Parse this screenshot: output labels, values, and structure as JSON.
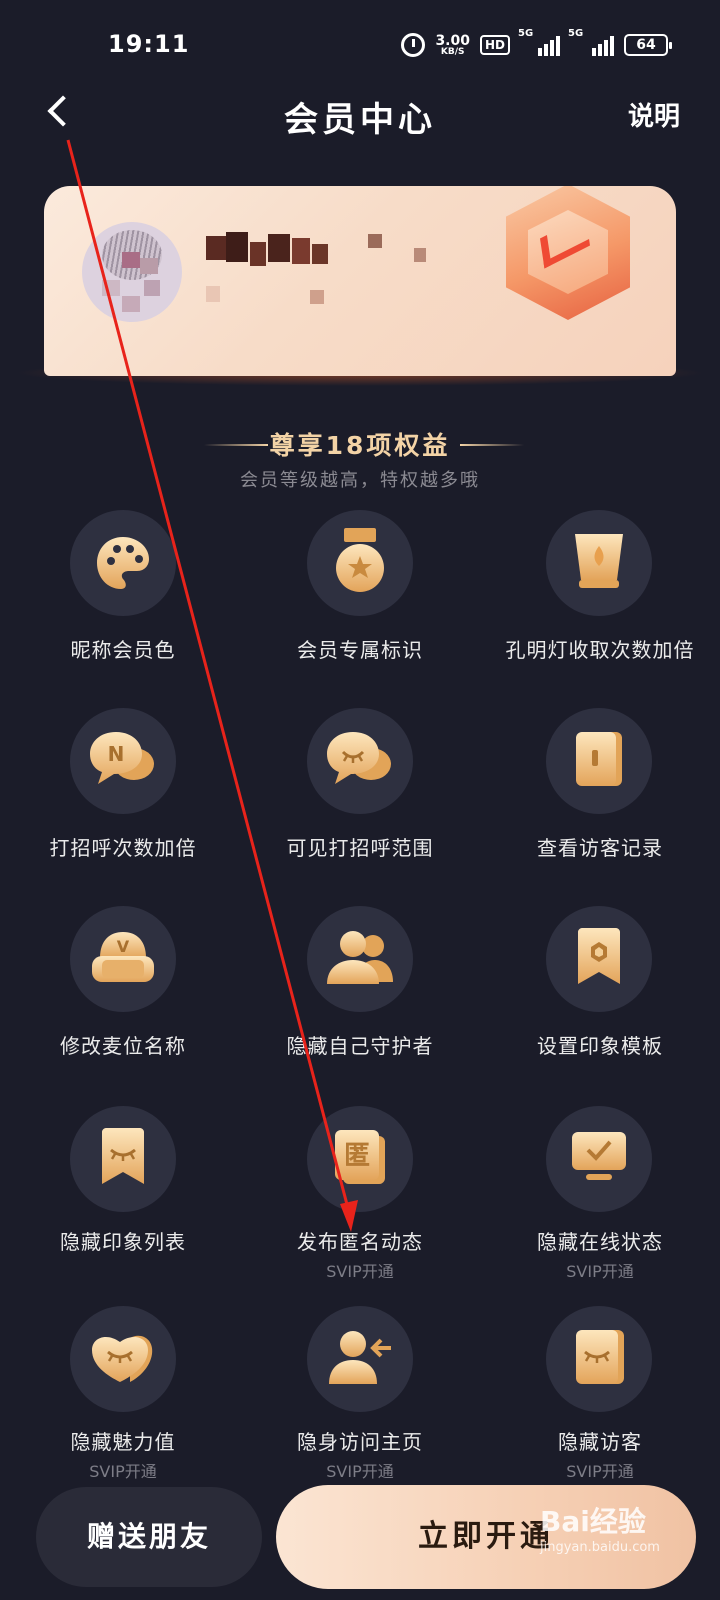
{
  "status_bar": {
    "time": "19:11",
    "net_speed": "3.00",
    "net_unit": "KB/S",
    "hd": "HD",
    "signal1": "5G",
    "signal2": "5G",
    "battery": "64",
    "icons": [
      "alarm-icon",
      "hd-icon",
      "signal-icon",
      "signal-icon",
      "battery-icon"
    ]
  },
  "header": {
    "title": "会员中心",
    "help": "说明",
    "back_icon": "back-chevron-icon"
  },
  "benefits": {
    "title": "尊享18项权益",
    "subtitle": "会员等级越高，特权越多哦",
    "items": [
      {
        "label": "昵称会员色",
        "icon": "palette-icon"
      },
      {
        "label": "会员专属标识",
        "icon": "medal-icon"
      },
      {
        "label": "孔明灯收取次数加倍",
        "icon": "lantern-icon"
      },
      {
        "label": "打招呼次数加倍",
        "icon": "chat-bubble-n-icon"
      },
      {
        "label": "可见打招呼范围",
        "icon": "chat-bubble-eye-icon"
      },
      {
        "label": "查看访客记录",
        "icon": "visitor-record-icon"
      },
      {
        "label": "修改麦位名称",
        "icon": "seat-icon"
      },
      {
        "label": "隐藏自己守护者",
        "icon": "users-icon"
      },
      {
        "label": "设置印象模板",
        "icon": "bookmark-template-icon"
      },
      {
        "label": "隐藏印象列表",
        "icon": "bookmark-hidden-icon"
      },
      {
        "label": "发布匿名动态",
        "note": "SVIP开通",
        "icon": "anonymous-icon",
        "icon_text": "匿"
      },
      {
        "label": "隐藏在线状态",
        "note": "SVIP开通",
        "icon": "monitor-check-icon"
      },
      {
        "label": "隐藏魅力值",
        "note": "SVIP开通",
        "icon": "heart-hidden-icon"
      },
      {
        "label": "隐身访问主页",
        "note": "SVIP开通",
        "icon": "invisible-visit-icon"
      },
      {
        "label": "隐藏访客",
        "note": "SVIP开通",
        "icon": "hidden-visitor-icon"
      }
    ]
  },
  "footer": {
    "gift": "赠送朋友",
    "activate": "立即开通"
  },
  "watermark": {
    "brand": "Bai经验",
    "url": "jingyan.baidu.com"
  },
  "colors": {
    "background": "#1b1c29",
    "gold": "#f3c07d",
    "accent_text": "#f3d3a6",
    "arrow": "#e8231b"
  }
}
